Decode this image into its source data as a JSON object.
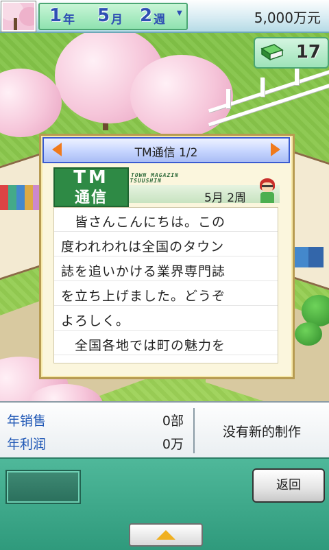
{
  "header": {
    "year_num": "1",
    "year_unit": "年",
    "month_num": "5",
    "month_unit": "月",
    "week_num": "2",
    "week_unit": "週",
    "money": "5,000万元"
  },
  "books": {
    "count": "17",
    "icon": "book-icon"
  },
  "dialog": {
    "title": "TM通信  1/2",
    "logo_main": "TM",
    "logo_sub": "通信",
    "logo_side": "TOWN MAGAZIN TSUUSHIN",
    "date": "5月  2周",
    "lines": [
      "　皆さんこんにちは。この",
      "度われわれは全国のタウン",
      "誌を追いかける業界専門誌",
      "を立ち上げました。どうぞ",
      "よろしく。",
      "　全国各地では町の魅力を"
    ]
  },
  "stats": {
    "sales_label": "年销售",
    "sales_value": "0部",
    "profit_label": "年利润",
    "profit_value": "0万",
    "status": "没有新的制作"
  },
  "footer": {
    "back_label": "返回"
  },
  "colors": {
    "accent_blue": "#2e4fb3",
    "dialog_border": "#3a5bd1",
    "footer_green": "#3aa88a",
    "arrow_orange": "#f07a1c"
  }
}
